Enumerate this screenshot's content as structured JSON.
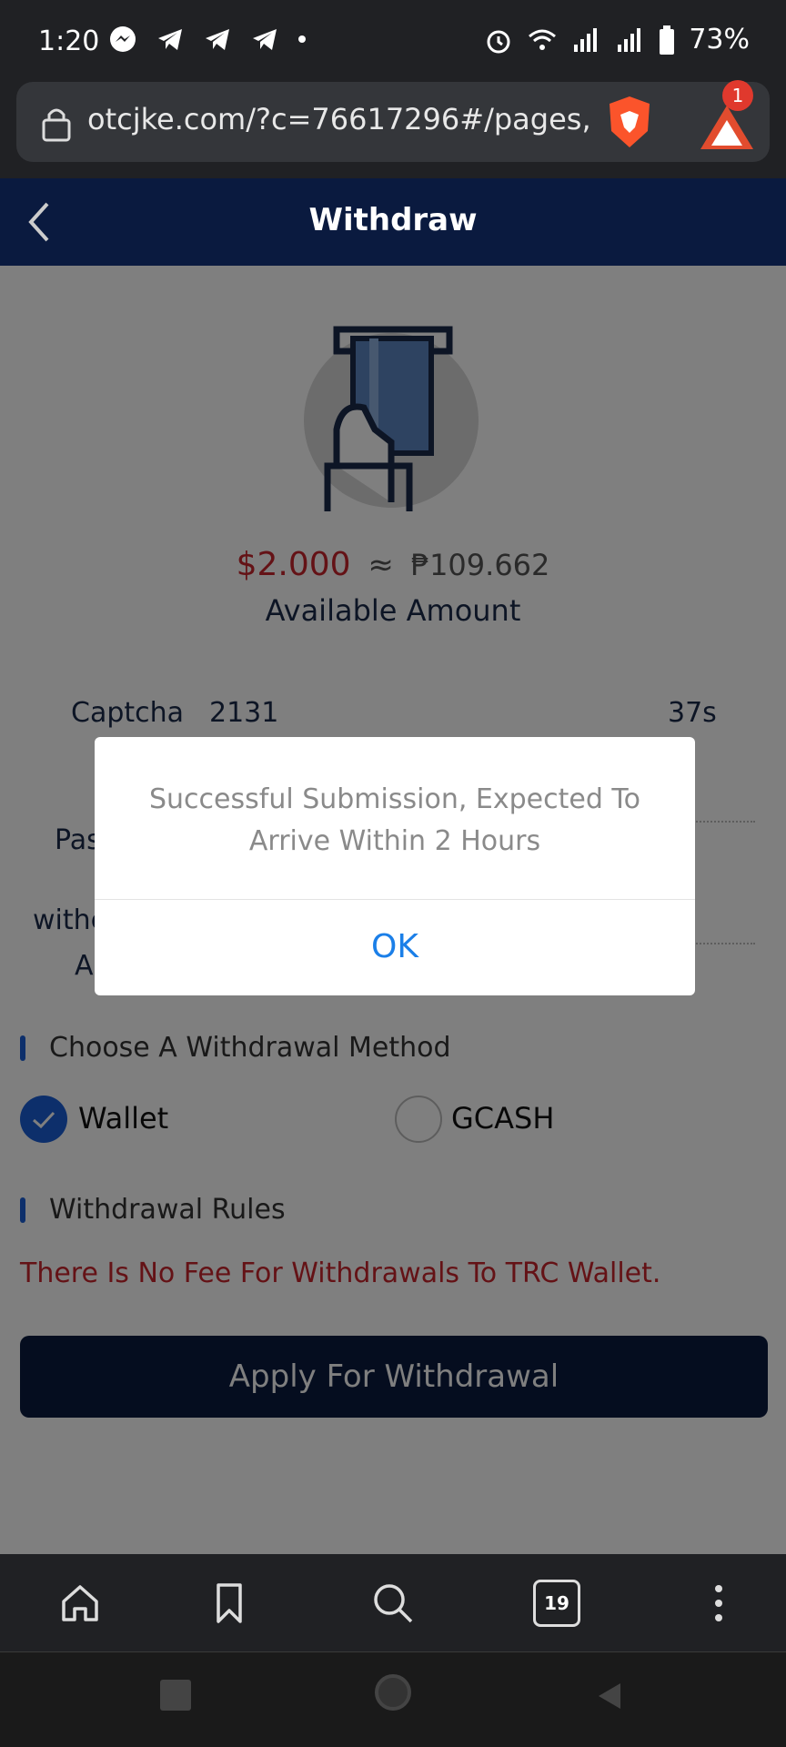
{
  "status_bar": {
    "time": "1:20",
    "battery": "73%",
    "left_icons": [
      "messenger-icon",
      "telegram-icon",
      "telegram-icon",
      "telegram-icon",
      "dot-icon"
    ],
    "right_icons": [
      "alarm-icon",
      "wifi-icon",
      "signal-icon",
      "signal-icon",
      "battery-icon"
    ]
  },
  "browser": {
    "url": "otcjke.com/?c=76617296#/pages,",
    "rewards_badge": "1",
    "tab_count": "19"
  },
  "header": {
    "title": "Withdraw"
  },
  "balance": {
    "usd": "$2.000",
    "approx": "≈",
    "php": "₱109.662",
    "label": "Available Amount"
  },
  "form": {
    "captcha_label": "Captcha",
    "captcha_value": "2131",
    "countdown": "37s",
    "password_label": "Pas",
    "address_label_1": "withe",
    "address_label_2": "A"
  },
  "method": {
    "title": "Choose A Withdrawal Method",
    "options": [
      {
        "label": "Wallet",
        "selected": true
      },
      {
        "label": "GCASH",
        "selected": false
      }
    ]
  },
  "rules": {
    "title": "Withdrawal Rules",
    "text": "There Is No Fee For Withdrawals To TRC Wallet."
  },
  "apply_button": "Apply For Withdrawal",
  "modal": {
    "message": "Successful Submission, Expected To Arrive Within 2 Hours",
    "ok": "OK"
  },
  "colors": {
    "header_bg": "#0a1a3f",
    "accent_blue": "#1b5fd6",
    "red": "#c9252c",
    "ok_blue": "#1b7fe8"
  }
}
